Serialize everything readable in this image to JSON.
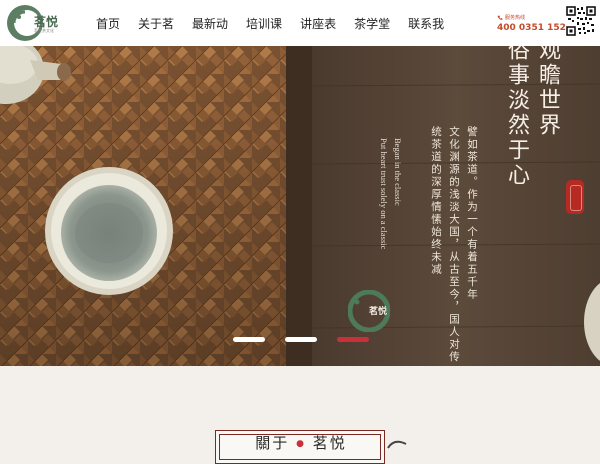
{
  "brand": {
    "name": "茗悦",
    "sub": "茗悦茶文化"
  },
  "nav": {
    "items": [
      "首页",
      "关于茗",
      "最新动",
      "培训课",
      "讲座表",
      "茶学堂",
      "联系我"
    ]
  },
  "hotline": {
    "label": "服务热线",
    "number": "400 0351 152"
  },
  "banner": {
    "headline": [
      "观瞻世界",
      "俗事淡然于心"
    ],
    "body_lines": [
      "譬如茶道。作为一个有着五千年",
      "文化渊源的浅淡大国，从古至今，国人对传",
      "统茶道的深厚情愫始终未减"
    ],
    "english_lines": [
      "Began in the classic",
      "Put heart trust solely on a classic"
    ],
    "logo_name": "茗悦",
    "slides": 3,
    "active_slide": 3
  },
  "about": {
    "title_left": "關于",
    "title_dot": "●",
    "title_right": "茗悦"
  },
  "colors": {
    "accent": "#c8313a",
    "brand_green": "#4a6b52",
    "hotline": "#c44a2a"
  },
  "icons": {
    "hotline": "phone-icon",
    "qr": "qr-code-icon",
    "logo": "tea-leaf-logo-icon"
  }
}
